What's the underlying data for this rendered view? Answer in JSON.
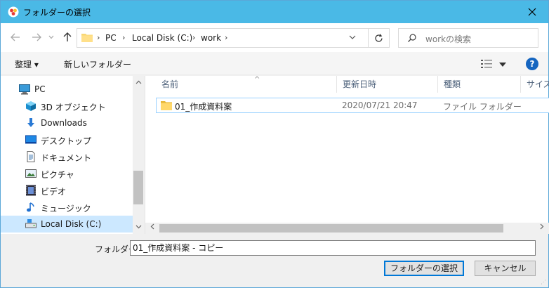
{
  "window": {
    "title": "フォルダーの選択",
    "accent_color": "#4ab9e6",
    "close_icon": "close-icon"
  },
  "address": {
    "crumbs": [
      "PC",
      "Local Disk (C:)",
      "work"
    ],
    "search_placeholder": "workの検索"
  },
  "toolbar": {
    "organize_label": "整理 ▾",
    "new_folder_label": "新しいフォルダー",
    "help_label": "?"
  },
  "nav": {
    "items": [
      {
        "label": "PC",
        "icon": "pc-icon"
      },
      {
        "label": "3D オブジェクト",
        "icon": "3d-objects-icon"
      },
      {
        "label": "Downloads",
        "icon": "download-icon"
      },
      {
        "label": "デスクトップ",
        "icon": "desktop-icon"
      },
      {
        "label": "ドキュメント",
        "icon": "document-icon"
      },
      {
        "label": "ピクチャ",
        "icon": "pictures-icon"
      },
      {
        "label": "ビデオ",
        "icon": "video-icon"
      },
      {
        "label": "ミュージック",
        "icon": "music-icon"
      },
      {
        "label": "Local Disk (C:)",
        "icon": "drive-icon"
      }
    ],
    "selected": "Local Disk (C:)"
  },
  "filelist": {
    "columns": [
      "名前",
      "更新日時",
      "種類",
      "サイズ"
    ],
    "rows": [
      {
        "name": "01_作成資料案",
        "modified": "2020/07/21 20:47",
        "type": "ファイル フォルダー"
      }
    ]
  },
  "bottom": {
    "folder_label": "フォルダー:",
    "folder_value": "01_作成資料案 - コピー",
    "select_button": "フォルダーの選択",
    "cancel_button": "キャンセル"
  }
}
